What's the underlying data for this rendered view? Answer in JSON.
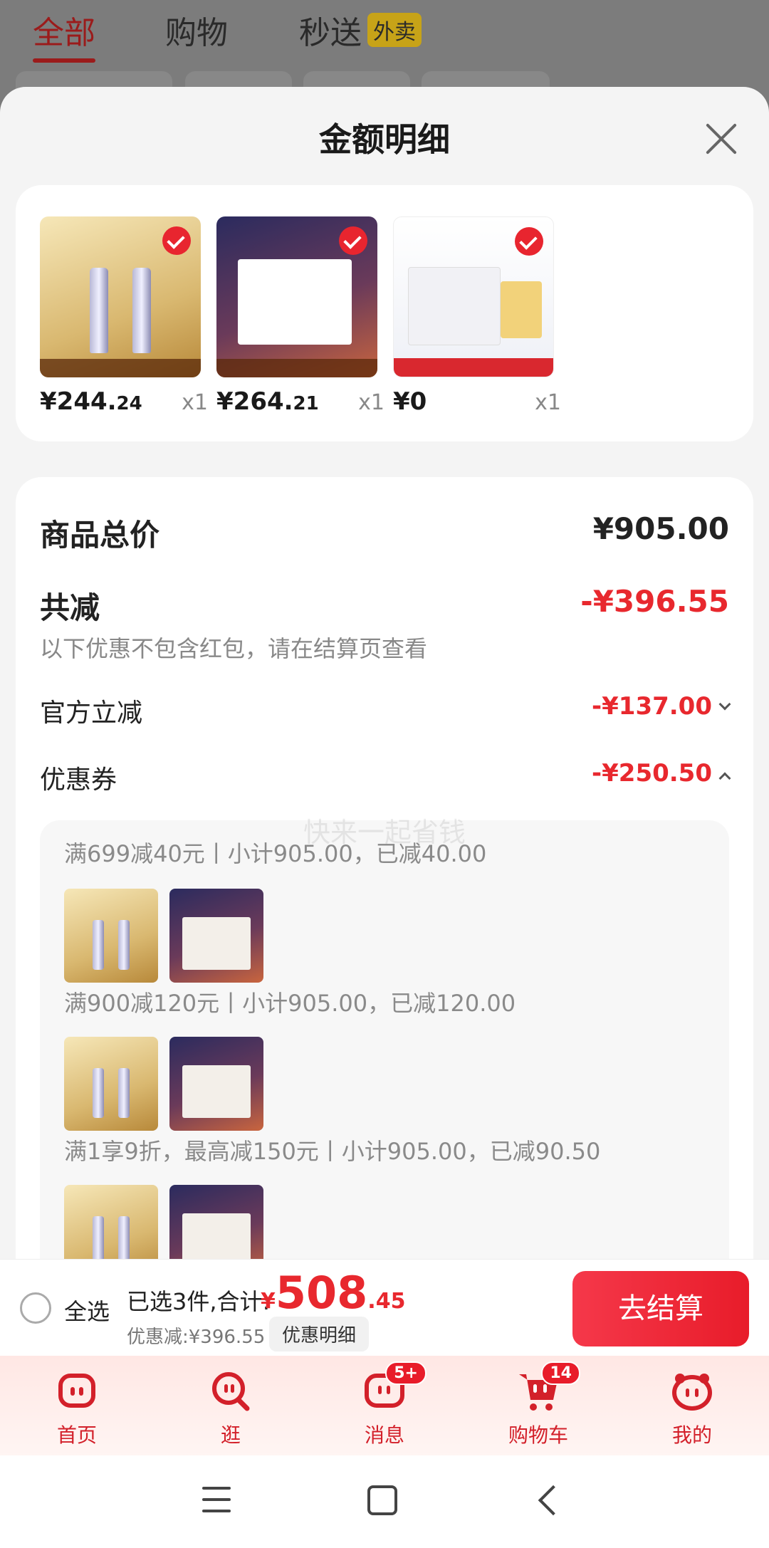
{
  "background": {
    "tabs": [
      {
        "label": "全部",
        "active": true
      },
      {
        "label": "购物",
        "active": false
      },
      {
        "label": "秒送",
        "active": false
      }
    ],
    "takeout_badge": "外卖"
  },
  "sheet": {
    "title": "金额明细",
    "products": [
      {
        "price_int": "¥244.",
        "price_dec": "24",
        "qty": "x1",
        "selected": true
      },
      {
        "price_int": "¥264.",
        "price_dec": "21",
        "qty": "x1",
        "selected": true
      },
      {
        "price_int": "¥0",
        "price_dec": "",
        "qty": "x1",
        "selected": true
      }
    ],
    "summary": {
      "total_label": "商品总价",
      "total_value": "¥905.00",
      "reduce_label": "共减",
      "reduce_value": "-¥396.55",
      "reduce_note": "以下优惠不包含红包，请在结算页查看",
      "official_label": "官方立减",
      "official_value": "-¥137.00",
      "coupon_label": "优惠券",
      "coupon_value": "-¥250.50",
      "watermark": "快来一起省钱"
    },
    "coupons": [
      {
        "text": "满699减40元丨小计905.00，已减40.00"
      },
      {
        "text": "满900减120元丨小计905.00，已减120.00"
      },
      {
        "text": "满1享9折，最高减150元丨小计905.00，已减90.50"
      }
    ]
  },
  "checkout": {
    "select_all": "全选",
    "selected_count": "已选3件,合计:",
    "currency": "¥",
    "total_int": "508",
    "total_dec": ".45",
    "discount": "优惠减:¥396.55",
    "detail_link": "优惠明细",
    "pay_button": "去结算"
  },
  "tabbar": {
    "items": [
      {
        "label": "首页"
      },
      {
        "label": "逛"
      },
      {
        "label": "消息",
        "badge": "5+"
      },
      {
        "label": "购物车",
        "badge": "14"
      },
      {
        "label": "我的"
      }
    ]
  },
  "colors": {
    "accent": "#e8282e",
    "tab_red": "#d3202a"
  }
}
